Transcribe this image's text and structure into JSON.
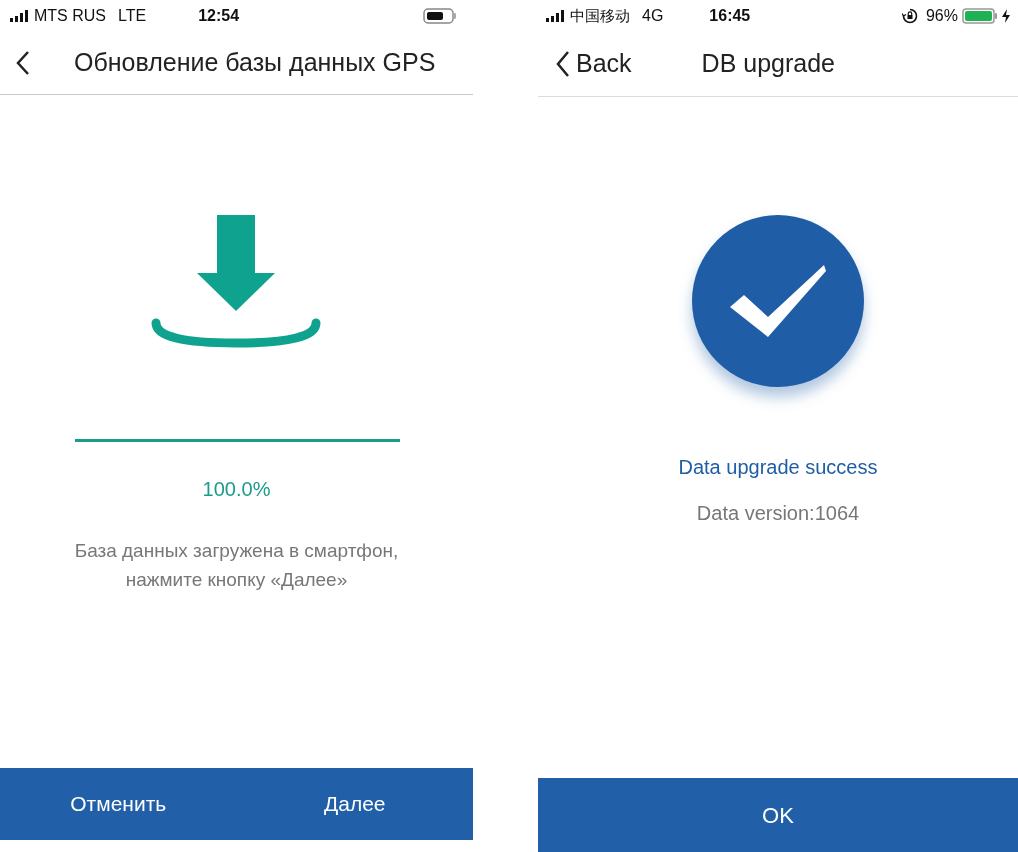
{
  "left_screen": {
    "status_bar": {
      "carrier": "MTS RUS",
      "network": "LTE",
      "time": "12:54"
    },
    "header": {
      "title": "Обновление базы данных GPS"
    },
    "progress": {
      "level": 1,
      "reading": "100.0%"
    },
    "message": "База данных загружена в смартфон, нажмите кнопку «Далее»",
    "buttons": [
      "Отменить",
      "Далее"
    ]
  },
  "right_screen": {
    "status_bar": {
      "carrier": "中国移动",
      "network": "4G",
      "time": "16:45",
      "battery": "96%"
    },
    "header": {
      "back": "Back",
      "title": "DB upgrade"
    },
    "result": {
      "title": "Data upgrade success",
      "detail": "Data version:1064"
    },
    "button": "OK"
  }
}
